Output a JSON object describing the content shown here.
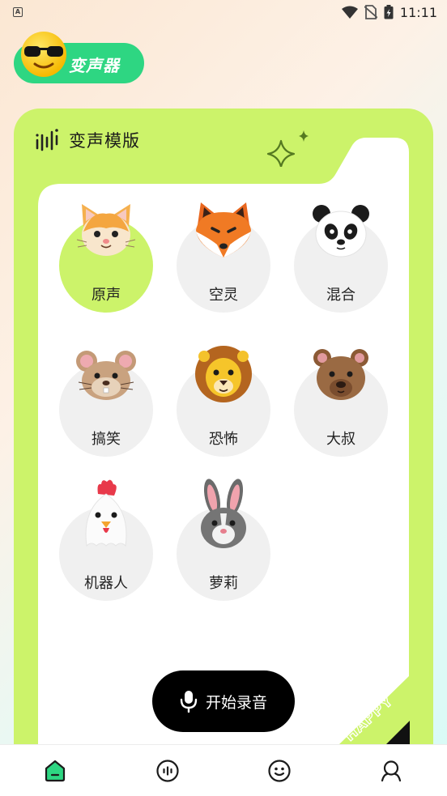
{
  "status_bar": {
    "time": "11:11",
    "notification_letter": "A"
  },
  "app": {
    "title": "变声器"
  },
  "panel": {
    "title": "变声模版",
    "corner_text": "HAPPY"
  },
  "voices": [
    {
      "label": "原声",
      "icon": "cat-face-icon",
      "selected": true
    },
    {
      "label": "空灵",
      "icon": "fox-face-icon",
      "selected": false
    },
    {
      "label": "混合",
      "icon": "panda-face-icon",
      "selected": false
    },
    {
      "label": "搞笑",
      "icon": "mouse-face-icon",
      "selected": false
    },
    {
      "label": "恐怖",
      "icon": "lion-face-icon",
      "selected": false
    },
    {
      "label": "大叔",
      "icon": "bear-face-icon",
      "selected": false
    },
    {
      "label": "机器人",
      "icon": "chicken-face-icon",
      "selected": false
    },
    {
      "label": "萝莉",
      "icon": "rabbit-face-icon",
      "selected": false
    }
  ],
  "record_button": {
    "label": "开始录音",
    "icon": "microphone-icon"
  },
  "bottom_nav": [
    {
      "icon": "home-icon",
      "active": true
    },
    {
      "icon": "voice-bubble-icon",
      "active": false
    },
    {
      "icon": "smiley-icon",
      "active": false
    },
    {
      "icon": "profile-icon",
      "active": false
    }
  ],
  "colors": {
    "brand_green": "#2ed682",
    "lime": "#ccf36a",
    "nav_active": "#2ed682",
    "record_button": "#000000"
  }
}
